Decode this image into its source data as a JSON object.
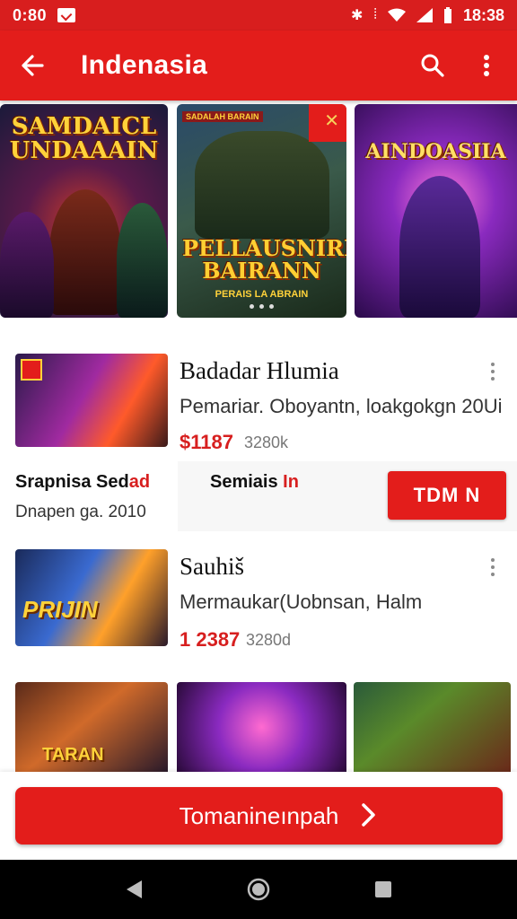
{
  "status_bar": {
    "time_left": "0:80",
    "time_right": "18:38",
    "icons": [
      "notification-icon",
      "bluetooth-icon",
      "vibrate-icon",
      "wifi-icon",
      "signal-icon",
      "battery-icon"
    ]
  },
  "app_bar": {
    "title": "Indenasia",
    "icons": [
      "back-arrow-icon",
      "search-icon",
      "more-vert-icon"
    ]
  },
  "carousel": {
    "banners": [
      {
        "text": "SAMDAICL UNDAAAIN"
      },
      {
        "badge": "SADALAH BARAIN",
        "text": "PELLAUSNIRN BAIRANN",
        "sub": "PERAIS LA ABRAIN"
      },
      {
        "text": "AINDOASIIA"
      }
    ]
  },
  "items": [
    {
      "title": "Badadar Hlumia",
      "subtitle": "Pemariar. Oboyantn, loakgokgn 20Ui",
      "price": "$1187",
      "meta": "3280k"
    },
    {
      "title": "Sauhiš",
      "subtitle": "Mermaukar(Uobnsan, Halm",
      "price": "1 2387",
      "meta": "3280d"
    }
  ],
  "promo": {
    "title": "Srapnisa Sed",
    "title_red": "ad",
    "subtitle": "Dnapen ga. 2010",
    "label": "Semiais ",
    "label_red": "In",
    "button": "TDM  N"
  },
  "thumb_texts": [
    "PRIJIN",
    "TARAN"
  ],
  "cta": {
    "label": "Tomanineınpah"
  },
  "colors": {
    "brand_red": "#e31d1b",
    "price_red": "#d71f1f"
  }
}
